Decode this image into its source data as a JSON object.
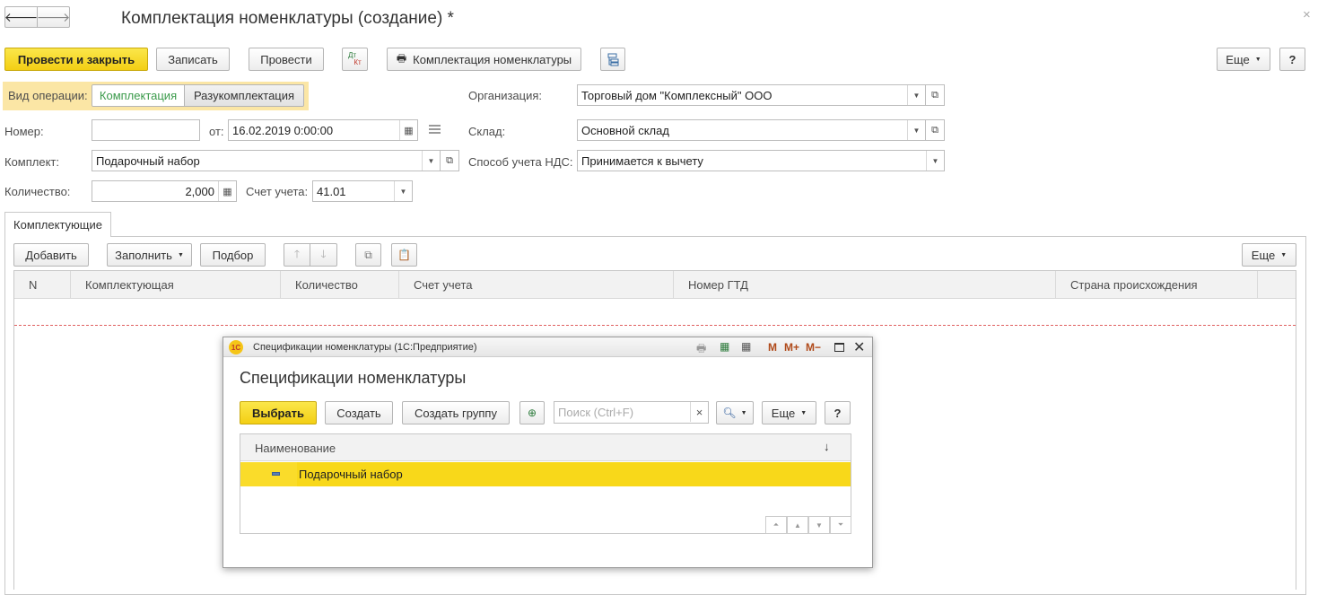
{
  "window": {
    "title": "Комплектация номенклатуры (создание) *",
    "close_glyph": "×"
  },
  "nav": {
    "back": "🡐",
    "forward": "🡒"
  },
  "toolbar": {
    "post_close": "Провести и закрыть",
    "save": "Записать",
    "post": "Провести",
    "dtkt_top": "Дт",
    "dtkt_bottom": "Кт",
    "print_label": "Комплектация номенклатуры",
    "more": "Еще",
    "help": "?"
  },
  "form": {
    "operation_label": "Вид операции:",
    "operation_options": [
      "Комплектация",
      "Разукомплектация"
    ],
    "org_label": "Организация:",
    "org_value": "Торговый дом \"Комплексный\" ООО",
    "number_label": "Номер:",
    "number_value": "",
    "from_label": "от:",
    "date_value": "16.02.2019  0:00:00",
    "warehouse_label": "Склад:",
    "warehouse_value": "Основной склад",
    "kit_label": "Комплект:",
    "kit_value": "Подарочный набор",
    "vat_label": "Способ учета НДС:",
    "vat_value": "Принимается к вычету",
    "qty_label": "Количество:",
    "qty_value": "2,000",
    "account_label": "Счет учета:",
    "account_value": "41.01"
  },
  "tab": {
    "label": "Комплектующие"
  },
  "table_toolbar": {
    "add": "Добавить",
    "fill": "Заполнить",
    "pick": "Подбор",
    "more": "Еще"
  },
  "table": {
    "columns": [
      "N",
      "Комплектующая",
      "Количество",
      "Счет учета",
      "Номер ГТД",
      "Страна происхождения"
    ]
  },
  "dialog": {
    "app_icon": "1С",
    "title": "Спецификации номенклатуры  (1С:Предприятие)",
    "heading": "Спецификации номенклатуры",
    "titlebar_m": "M",
    "titlebar_mplus": "M+",
    "titlebar_mminus": "M−",
    "select": "Выбрать",
    "create": "Создать",
    "create_group": "Создать группу",
    "search_placeholder": "Поиск (Ctrl+F)",
    "search_clear": "×",
    "more": "Еще",
    "help": "?",
    "column": "Наименование",
    "sort_glyph": "↓",
    "rows": [
      {
        "name": "Подарочный набор"
      }
    ]
  },
  "colors": {
    "accent_yellow": "#f5d31b",
    "row_highlight": "#fadc2a",
    "tab_green": "#3a9a4a"
  }
}
